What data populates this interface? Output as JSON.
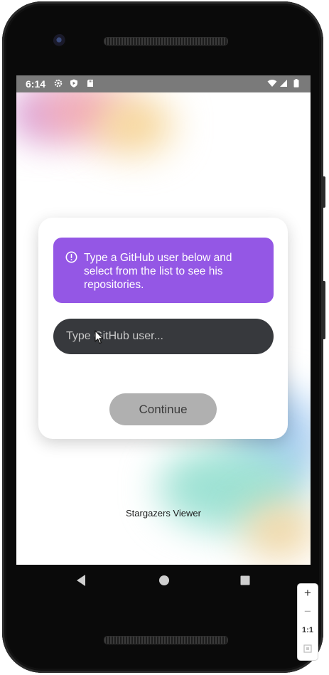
{
  "status_bar": {
    "time": "6:14",
    "left_icons": [
      "gear-icon",
      "play-protect-icon",
      "sd-card-icon"
    ],
    "right_icons": [
      "wifi-icon",
      "cell-signal-icon",
      "battery-icon"
    ]
  },
  "card": {
    "info_icon": "exclamation-circle-icon",
    "info_text": "Type a GitHub user below and select from the list to see his repositories.",
    "input_placeholder": "Type GitHub user...",
    "input_value": "",
    "continue_label": "Continue"
  },
  "footer": {
    "app_name": "Stargazers Viewer"
  },
  "nav_bar": {
    "buttons": [
      "back-icon",
      "home-icon",
      "recents-icon"
    ]
  },
  "zoom_controls": {
    "plus": "+",
    "minus": "−",
    "ratio": "1:1"
  },
  "colors": {
    "info_background": "#9457e5",
    "input_background": "#37393d",
    "button_background": "#b0b0b0",
    "status_bar": "#7a7a7a"
  }
}
